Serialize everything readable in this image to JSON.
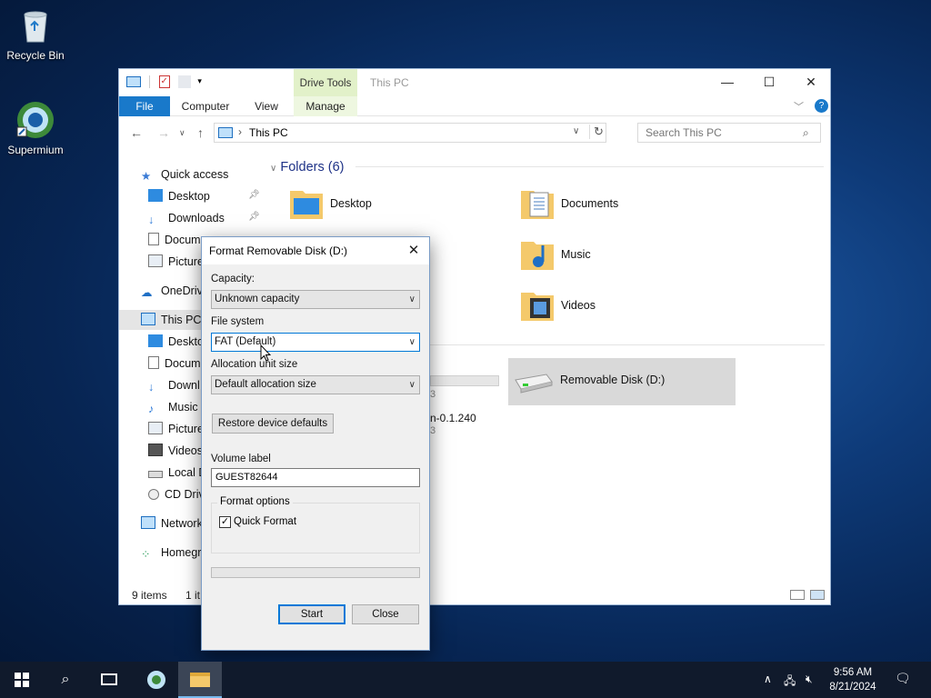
{
  "desktop": {
    "icons": [
      {
        "label": "Recycle Bin"
      },
      {
        "label": "Supermium"
      }
    ]
  },
  "explorer": {
    "window_title": "This PC",
    "contextual_tab": "Drive Tools",
    "tabs": [
      "File",
      "Computer",
      "View",
      "Manage"
    ],
    "address": "This PC",
    "search_placeholder": "Search This PC",
    "nav": [
      {
        "label": "Quick access",
        "icon": "star-icon"
      },
      {
        "label": "Desktop",
        "icon": "desktop-icon",
        "pinned": true
      },
      {
        "label": "Downloads",
        "icon": "downloads-icon",
        "pinned": true
      },
      {
        "label": "Docum",
        "icon": "documents-icon"
      },
      {
        "label": "Picture",
        "icon": "pictures-icon"
      },
      {
        "label": "OneDriv",
        "icon": "onedrive-icon"
      },
      {
        "label": "This PC",
        "icon": "this-pc-icon"
      },
      {
        "label": "Deskto",
        "icon": "desktop-icon"
      },
      {
        "label": "Docum",
        "icon": "documents-icon"
      },
      {
        "label": "Downl",
        "icon": "downloads-icon"
      },
      {
        "label": "Music",
        "icon": "music-icon"
      },
      {
        "label": "Picture",
        "icon": "pictures-icon"
      },
      {
        "label": "Videos",
        "icon": "videos-icon"
      },
      {
        "label": "Local D",
        "icon": "local-disk-icon"
      },
      {
        "label": "CD Driv",
        "icon": "cd-drive-icon"
      },
      {
        "label": "Network",
        "icon": "network-icon"
      },
      {
        "label": "Homegr",
        "icon": "homegroup-icon"
      }
    ],
    "folders_heading": "Folders (6)",
    "folders": [
      {
        "label": "Desktop",
        "icon": "desktop-folder-icon"
      },
      {
        "label": "Documents",
        "icon": "documents-folder-icon"
      },
      {
        "label": "Music",
        "icon": "music-folder-icon"
      },
      {
        "label": "Videos",
        "icon": "videos-folder-icon"
      }
    ],
    "devices": {
      "removable_disk": "Removable Disk (D:)",
      "partial_fragment_1": "3",
      "partial_fragment_2": "n-0.1.240",
      "partial_fragment_3": "3"
    },
    "status": {
      "items": "9 items",
      "selected": "1 it"
    }
  },
  "format_dialog": {
    "title": "Format Removable Disk (D:)",
    "capacity_label": "Capacity:",
    "capacity_value": "Unknown capacity",
    "filesystem_label": "File system",
    "filesystem_value": "FAT (Default)",
    "allocation_label": "Allocation unit size",
    "allocation_value": "Default allocation size",
    "restore_button": "Restore device defaults",
    "volume_label_label": "Volume label",
    "volume_label_value": "GUEST82644",
    "format_options_label": "Format options",
    "quick_format_label": "Quick Format",
    "quick_format_checked": true,
    "start_button": "Start",
    "close_button": "Close"
  },
  "taskbar": {
    "time": "9:56 AM",
    "date": "8/21/2024"
  }
}
